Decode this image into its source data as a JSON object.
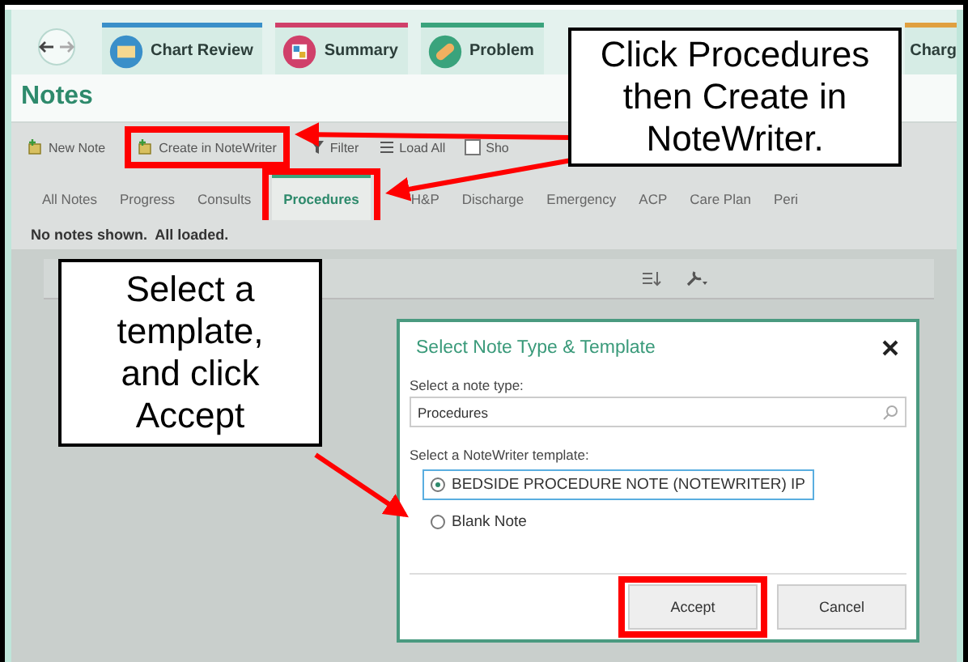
{
  "activity_tabs": [
    {
      "label": "Chart Review",
      "color": "#3a8fc9",
      "kind": "chart"
    },
    {
      "label": "Summary",
      "color": "#d0406a",
      "kind": "summary"
    },
    {
      "label": "Problem",
      "color": "#3aa37c",
      "kind": "problem"
    },
    {
      "label": "Charg",
      "color": "#e0a040",
      "kind": "none"
    }
  ],
  "panel": {
    "title": "Notes"
  },
  "toolbar": [
    {
      "label": "New Note",
      "kind": "new",
      "highlighted": false
    },
    {
      "label": "Create in NoteWriter",
      "kind": "new",
      "highlighted": true
    },
    {
      "label": "Filter",
      "kind": "filter",
      "highlighted": false
    },
    {
      "label": "Load All",
      "kind": "list",
      "highlighted": false
    },
    {
      "label": "Sho",
      "kind": "checkbox",
      "checked": false,
      "highlighted": false
    }
  ],
  "note_tabs": [
    {
      "label": "All Notes",
      "selected": false
    },
    {
      "label": "Progress",
      "selected": false
    },
    {
      "label": "Consults",
      "selected": false
    },
    {
      "label": "Procedures",
      "selected": true,
      "highlighted": true
    },
    {
      "label": "H&P",
      "selected": false
    },
    {
      "label": "Discharge",
      "selected": false
    },
    {
      "label": "Emergency",
      "selected": false
    },
    {
      "label": "ACP",
      "selected": false
    },
    {
      "label": "Care Plan",
      "selected": false
    },
    {
      "label": "Peri",
      "selected": false
    }
  ],
  "status": "No notes shown.  All loaded.",
  "dialog": {
    "title": "Select Note Type & Template",
    "type_label": "Select a note type:",
    "type_value": "Procedures",
    "template_label": "Select a NoteWriter template:",
    "templates": [
      {
        "label": "BEDSIDE PROCEDURE NOTE (NOTEWRITER) IP",
        "selected": true
      },
      {
        "label": "Blank Note",
        "selected": false
      }
    ],
    "buttons": [
      {
        "label": "Accept",
        "highlighted": true
      },
      {
        "label": "Cancel",
        "highlighted": false
      }
    ]
  },
  "callouts": [
    {
      "text": "Click Procedures then Create in NoteWriter."
    },
    {
      "text": "Select a template, and click Accept"
    }
  ]
}
